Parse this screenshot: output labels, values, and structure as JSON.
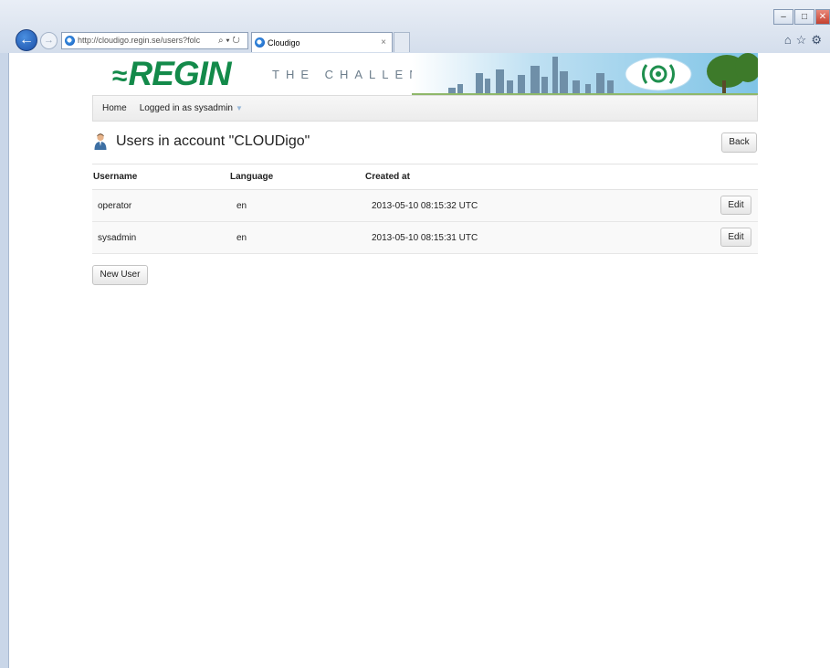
{
  "browser": {
    "address": "http://cloudigo.regin.se/users?folc",
    "address_tools": "⌕ ▾ ↻",
    "tab_title": "Cloudigo",
    "tab_close": "×",
    "window_buttons": [
      "–",
      "□",
      "✕"
    ],
    "toolbar_icons": "⌂☆⚙"
  },
  "banner": {
    "logo_text": "REGIN",
    "tagline": "THE CHALLENGER",
    "logo_color": "#138a4a"
  },
  "nav": {
    "home": "Home",
    "user_menu": "Logged in as sysadmin"
  },
  "page": {
    "title": "Users in account \"CLOUDigo\"",
    "back_label": "Back",
    "new_user_label": "New User"
  },
  "table": {
    "headers": [
      "Username",
      "Language",
      "Created at"
    ],
    "rows": [
      {
        "username": "operator",
        "language": "en",
        "created_at": "2013-05-10 08:15:32 UTC",
        "action": "Edit"
      },
      {
        "username": "sysadmin",
        "language": "en",
        "created_at": "2013-05-10 08:15:31 UTC",
        "action": "Edit"
      }
    ]
  }
}
